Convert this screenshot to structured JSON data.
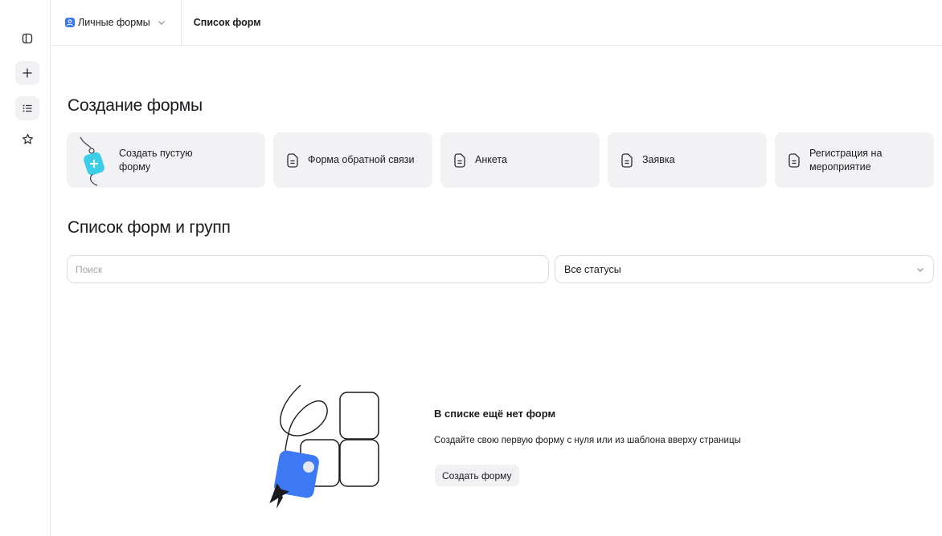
{
  "header": {
    "workspace": "Личные формы",
    "breadcrumb": "Список форм"
  },
  "create_section": {
    "title": "Создание формы",
    "templates": [
      {
        "label": "Создать пустую форму"
      },
      {
        "label": "Форма обратной связи"
      },
      {
        "label": "Анкета"
      },
      {
        "label": "Заявка"
      },
      {
        "label": "Регистрация на мероприятие"
      }
    ]
  },
  "list_section": {
    "title": "Список форм и групп",
    "search_placeholder": "Поиск",
    "search_value": "",
    "status_filter": "Все статусы"
  },
  "empty_state": {
    "title": "В списке ещё нет форм",
    "subtitle": "Создайте свою первую форму с нуля или из шаблона вверху страницы",
    "button": "Создать форму"
  },
  "colors": {
    "accent": "#3d78f5",
    "card_bg": "#f2f2f4",
    "tag_cyan": "#3ccde8"
  },
  "icons": {
    "rail": [
      "sidebar-toggle-icon",
      "plus-icon",
      "list-icon",
      "star-icon"
    ],
    "template": "document-icon"
  }
}
